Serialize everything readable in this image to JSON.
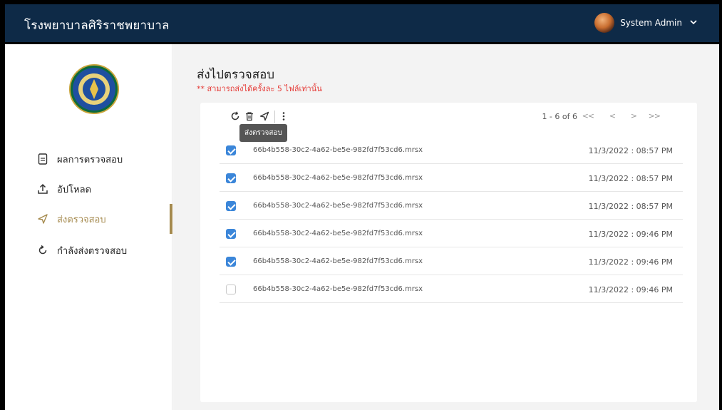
{
  "header": {
    "app_title": "โรงพยาบาลศิริราชพยาบาล",
    "user_name": "System Admin",
    "user_chevron_icon": "chevron-down-icon"
  },
  "sidebar": {
    "items": [
      {
        "label": "ผลการตรวจสอบ",
        "icon": "document-icon",
        "active": false
      },
      {
        "label": "อัปโหลด",
        "icon": "upload-icon",
        "active": false
      },
      {
        "label": "ส่งตรวจสอบ",
        "icon": "send-icon",
        "active": true
      },
      {
        "label": "กำลังส่งตรวจสอบ",
        "icon": "refresh-icon",
        "active": false
      }
    ],
    "accent_color": "#a58a4e"
  },
  "main": {
    "title": "ส่งไปตรวจสอบ",
    "note": "** สามารถส่งได้ครั้งละ 5 ไฟล์เท่านั้น",
    "toolbar": {
      "tooltip": "ส่งตรวจสอบ",
      "icons": [
        "refresh-icon",
        "trash-icon",
        "send-icon",
        "more-vertical-icon"
      ]
    },
    "pager": {
      "range_text": "1 - 6 of 6",
      "first": "<<",
      "prev": "<",
      "next": ">",
      "last": ">>"
    },
    "rows": [
      {
        "name": "66b4b558-30c2-4a62-be5e-982fd7f53cd6.mrsx",
        "date": "11/3/2022 : 08:57 PM",
        "checked": true
      },
      {
        "name": "66b4b558-30c2-4a62-be5e-982fd7f53cd6.mrsx",
        "date": "11/3/2022 : 08:57 PM",
        "checked": true
      },
      {
        "name": "66b4b558-30c2-4a62-be5e-982fd7f53cd6.mrsx",
        "date": "11/3/2022 : 08:57 PM",
        "checked": true
      },
      {
        "name": "66b4b558-30c2-4a62-be5e-982fd7f53cd6.mrsx",
        "date": "11/3/2022 : 09:46 PM",
        "checked": true
      },
      {
        "name": "66b4b558-30c2-4a62-be5e-982fd7f53cd6.mrsx",
        "date": "11/3/2022 : 09:46 PM",
        "checked": true
      },
      {
        "name": "66b4b558-30c2-4a62-be5e-982fd7f53cd6.mrsx",
        "date": "11/3/2022 : 09:46 PM",
        "checked": false
      }
    ]
  },
  "colors": {
    "header_bg": "#0e2a47",
    "checkbox_checked": "#3b86d9",
    "note_red": "#e53935"
  }
}
